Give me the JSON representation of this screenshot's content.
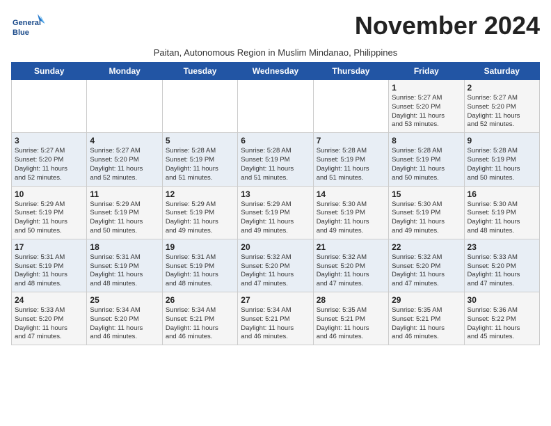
{
  "logo": {
    "text_line1": "General",
    "text_line2": "Blue"
  },
  "header": {
    "month_year": "November 2024",
    "subtitle": "Paitan, Autonomous Region in Muslim Mindanao, Philippines"
  },
  "days_of_week": [
    "Sunday",
    "Monday",
    "Tuesday",
    "Wednesday",
    "Thursday",
    "Friday",
    "Saturday"
  ],
  "weeks": [
    {
      "days": [
        {
          "number": "",
          "info": ""
        },
        {
          "number": "",
          "info": ""
        },
        {
          "number": "",
          "info": ""
        },
        {
          "number": "",
          "info": ""
        },
        {
          "number": "",
          "info": ""
        },
        {
          "number": "1",
          "info": "Sunrise: 5:27 AM\nSunset: 5:20 PM\nDaylight: 11 hours\nand 53 minutes."
        },
        {
          "number": "2",
          "info": "Sunrise: 5:27 AM\nSunset: 5:20 PM\nDaylight: 11 hours\nand 52 minutes."
        }
      ]
    },
    {
      "days": [
        {
          "number": "3",
          "info": "Sunrise: 5:27 AM\nSunset: 5:20 PM\nDaylight: 11 hours\nand 52 minutes."
        },
        {
          "number": "4",
          "info": "Sunrise: 5:27 AM\nSunset: 5:20 PM\nDaylight: 11 hours\nand 52 minutes."
        },
        {
          "number": "5",
          "info": "Sunrise: 5:28 AM\nSunset: 5:19 PM\nDaylight: 11 hours\nand 51 minutes."
        },
        {
          "number": "6",
          "info": "Sunrise: 5:28 AM\nSunset: 5:19 PM\nDaylight: 11 hours\nand 51 minutes."
        },
        {
          "number": "7",
          "info": "Sunrise: 5:28 AM\nSunset: 5:19 PM\nDaylight: 11 hours\nand 51 minutes."
        },
        {
          "number": "8",
          "info": "Sunrise: 5:28 AM\nSunset: 5:19 PM\nDaylight: 11 hours\nand 50 minutes."
        },
        {
          "number": "9",
          "info": "Sunrise: 5:28 AM\nSunset: 5:19 PM\nDaylight: 11 hours\nand 50 minutes."
        }
      ]
    },
    {
      "days": [
        {
          "number": "10",
          "info": "Sunrise: 5:29 AM\nSunset: 5:19 PM\nDaylight: 11 hours\nand 50 minutes."
        },
        {
          "number": "11",
          "info": "Sunrise: 5:29 AM\nSunset: 5:19 PM\nDaylight: 11 hours\nand 50 minutes."
        },
        {
          "number": "12",
          "info": "Sunrise: 5:29 AM\nSunset: 5:19 PM\nDaylight: 11 hours\nand 49 minutes."
        },
        {
          "number": "13",
          "info": "Sunrise: 5:29 AM\nSunset: 5:19 PM\nDaylight: 11 hours\nand 49 minutes."
        },
        {
          "number": "14",
          "info": "Sunrise: 5:30 AM\nSunset: 5:19 PM\nDaylight: 11 hours\nand 49 minutes."
        },
        {
          "number": "15",
          "info": "Sunrise: 5:30 AM\nSunset: 5:19 PM\nDaylight: 11 hours\nand 49 minutes."
        },
        {
          "number": "16",
          "info": "Sunrise: 5:30 AM\nSunset: 5:19 PM\nDaylight: 11 hours\nand 48 minutes."
        }
      ]
    },
    {
      "days": [
        {
          "number": "17",
          "info": "Sunrise: 5:31 AM\nSunset: 5:19 PM\nDaylight: 11 hours\nand 48 minutes."
        },
        {
          "number": "18",
          "info": "Sunrise: 5:31 AM\nSunset: 5:19 PM\nDaylight: 11 hours\nand 48 minutes."
        },
        {
          "number": "19",
          "info": "Sunrise: 5:31 AM\nSunset: 5:19 PM\nDaylight: 11 hours\nand 48 minutes."
        },
        {
          "number": "20",
          "info": "Sunrise: 5:32 AM\nSunset: 5:20 PM\nDaylight: 11 hours\nand 47 minutes."
        },
        {
          "number": "21",
          "info": "Sunrise: 5:32 AM\nSunset: 5:20 PM\nDaylight: 11 hours\nand 47 minutes."
        },
        {
          "number": "22",
          "info": "Sunrise: 5:32 AM\nSunset: 5:20 PM\nDaylight: 11 hours\nand 47 minutes."
        },
        {
          "number": "23",
          "info": "Sunrise: 5:33 AM\nSunset: 5:20 PM\nDaylight: 11 hours\nand 47 minutes."
        }
      ]
    },
    {
      "days": [
        {
          "number": "24",
          "info": "Sunrise: 5:33 AM\nSunset: 5:20 PM\nDaylight: 11 hours\nand 47 minutes."
        },
        {
          "number": "25",
          "info": "Sunrise: 5:34 AM\nSunset: 5:20 PM\nDaylight: 11 hours\nand 46 minutes."
        },
        {
          "number": "26",
          "info": "Sunrise: 5:34 AM\nSunset: 5:21 PM\nDaylight: 11 hours\nand 46 minutes."
        },
        {
          "number": "27",
          "info": "Sunrise: 5:34 AM\nSunset: 5:21 PM\nDaylight: 11 hours\nand 46 minutes."
        },
        {
          "number": "28",
          "info": "Sunrise: 5:35 AM\nSunset: 5:21 PM\nDaylight: 11 hours\nand 46 minutes."
        },
        {
          "number": "29",
          "info": "Sunrise: 5:35 AM\nSunset: 5:21 PM\nDaylight: 11 hours\nand 46 minutes."
        },
        {
          "number": "30",
          "info": "Sunrise: 5:36 AM\nSunset: 5:22 PM\nDaylight: 11 hours\nand 45 minutes."
        }
      ]
    }
  ]
}
